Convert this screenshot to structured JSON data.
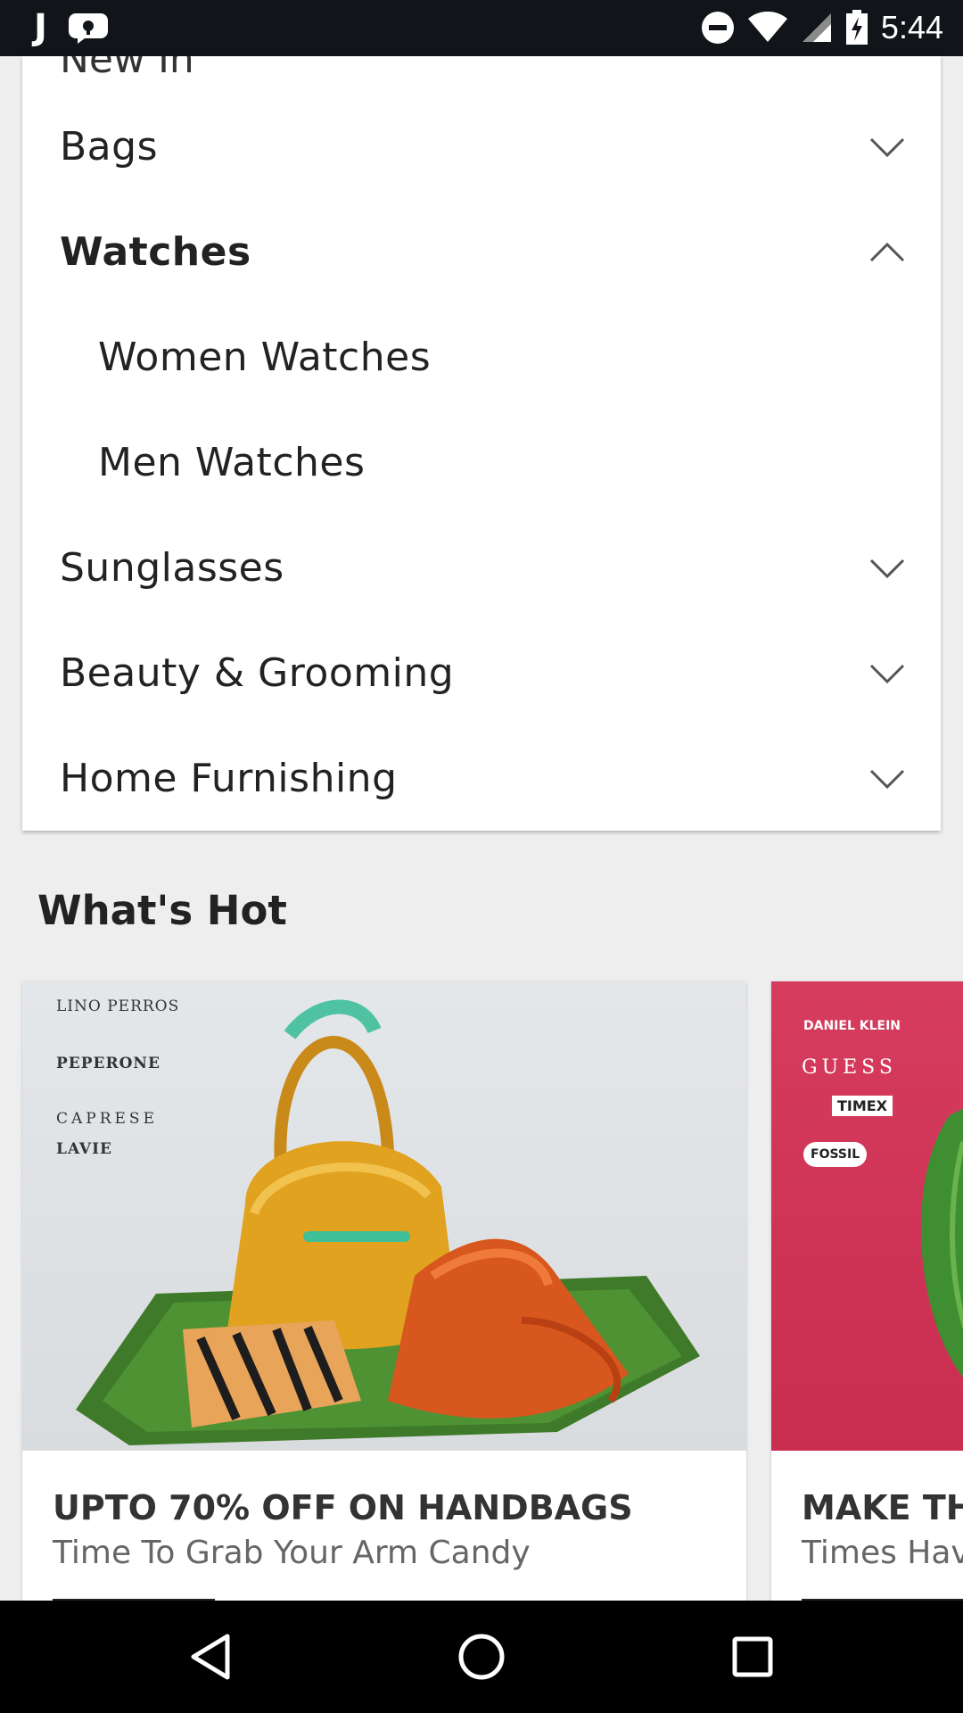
{
  "status_bar": {
    "app_letter": "J",
    "time": "5:44"
  },
  "categories": {
    "partial_top_label": "New In",
    "items": [
      {
        "label": "Bags",
        "expanded": false
      },
      {
        "label": "Watches",
        "expanded": true
      },
      {
        "label": "Women Watches",
        "sub": true
      },
      {
        "label": "Men Watches",
        "sub": true
      },
      {
        "label": "Sunglasses",
        "expanded": false
      },
      {
        "label": "Beauty & Grooming",
        "expanded": false
      },
      {
        "label": "Home Furnishing",
        "expanded": false
      }
    ]
  },
  "whats_hot": {
    "title": "What's Hot",
    "cards": [
      {
        "title": "UPTO 70% OFF ON HANDBAGS",
        "subtitle": "Time To Grab Your Arm Candy",
        "brands": [
          "LINO PERROS",
          "PEPERONE",
          "CAPRESE",
          "LAVIE"
        ]
      },
      {
        "title": "MAKE THI",
        "subtitle": "Times Have",
        "brands": [
          "DANIEL KLEIN",
          "GUESS",
          "TIMEX",
          "FOSSIL"
        ]
      }
    ]
  },
  "icons": {
    "chevron_down": "chevron-down-icon",
    "chevron_up": "chevron-up-icon",
    "back": "back-triangle-icon",
    "home": "home-circle-icon",
    "recents": "recents-square-icon"
  }
}
